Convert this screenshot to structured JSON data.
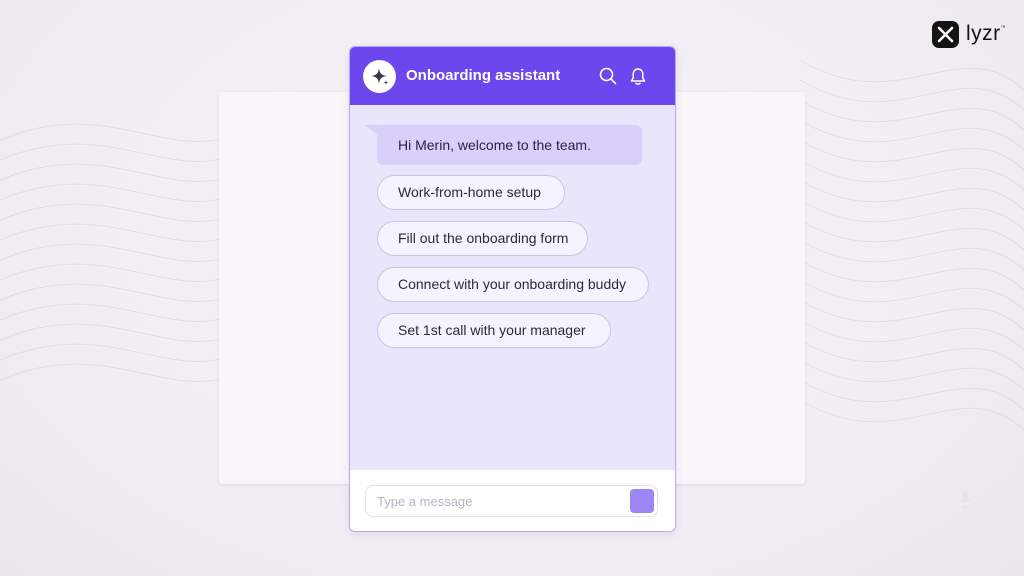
{
  "brand": {
    "name": "lyzr",
    "mark": "™"
  },
  "chat": {
    "title": "Onboarding assistant",
    "avatar_icon": "sparkle-icon",
    "header_icons": [
      "search-icon",
      "bell-icon"
    ],
    "greeting": "Hi Merin, welcome to the team.",
    "options": [
      {
        "label": "Work-from-home setup"
      },
      {
        "label": "Fill out the onboarding form"
      },
      {
        "label": "Connect with your onboarding buddy"
      },
      {
        "label": "Set 1st call with your manager"
      }
    ],
    "input": {
      "placeholder": "Type a message",
      "value": ""
    }
  },
  "colors": {
    "header": "#6c47ee",
    "chat_bg": "#e9e5fb",
    "bubble": "#d8cffb",
    "send": "#9b86f3"
  }
}
